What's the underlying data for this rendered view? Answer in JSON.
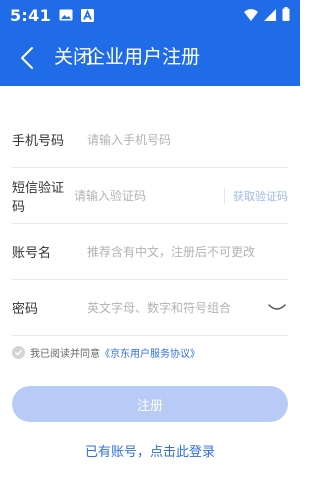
{
  "status_bar": {
    "time": "5:41",
    "icons": [
      "image-icon",
      "a-badge-icon",
      "wifi-icon",
      "signal-icon",
      "battery-icon"
    ]
  },
  "app_bar": {
    "back_icon": "chevron-left-icon",
    "close_label": "关闭",
    "title": "企业用户注册"
  },
  "form": {
    "phone": {
      "label": "手机号码",
      "placeholder": "请输入手机号码"
    },
    "sms": {
      "label": "短信验证码",
      "placeholder": "请输入验证码",
      "get_code": "获取验证码"
    },
    "account": {
      "label": "账号名",
      "placeholder": "推荐含有中文，注册后不可更改"
    },
    "password": {
      "label": "密码",
      "placeholder": "英文字母、数字和符号组合",
      "toggle_icon": "eye-closed-icon"
    }
  },
  "agreement": {
    "prefix": "我已阅读并同意",
    "link": "《京东用户服务协议》"
  },
  "register_button": "注册",
  "login_link": "已有账号，点击此登录",
  "colors": {
    "primary": "#1f6be8",
    "button_disabled": "#b8cbf7",
    "link": "#2f6fe6"
  }
}
